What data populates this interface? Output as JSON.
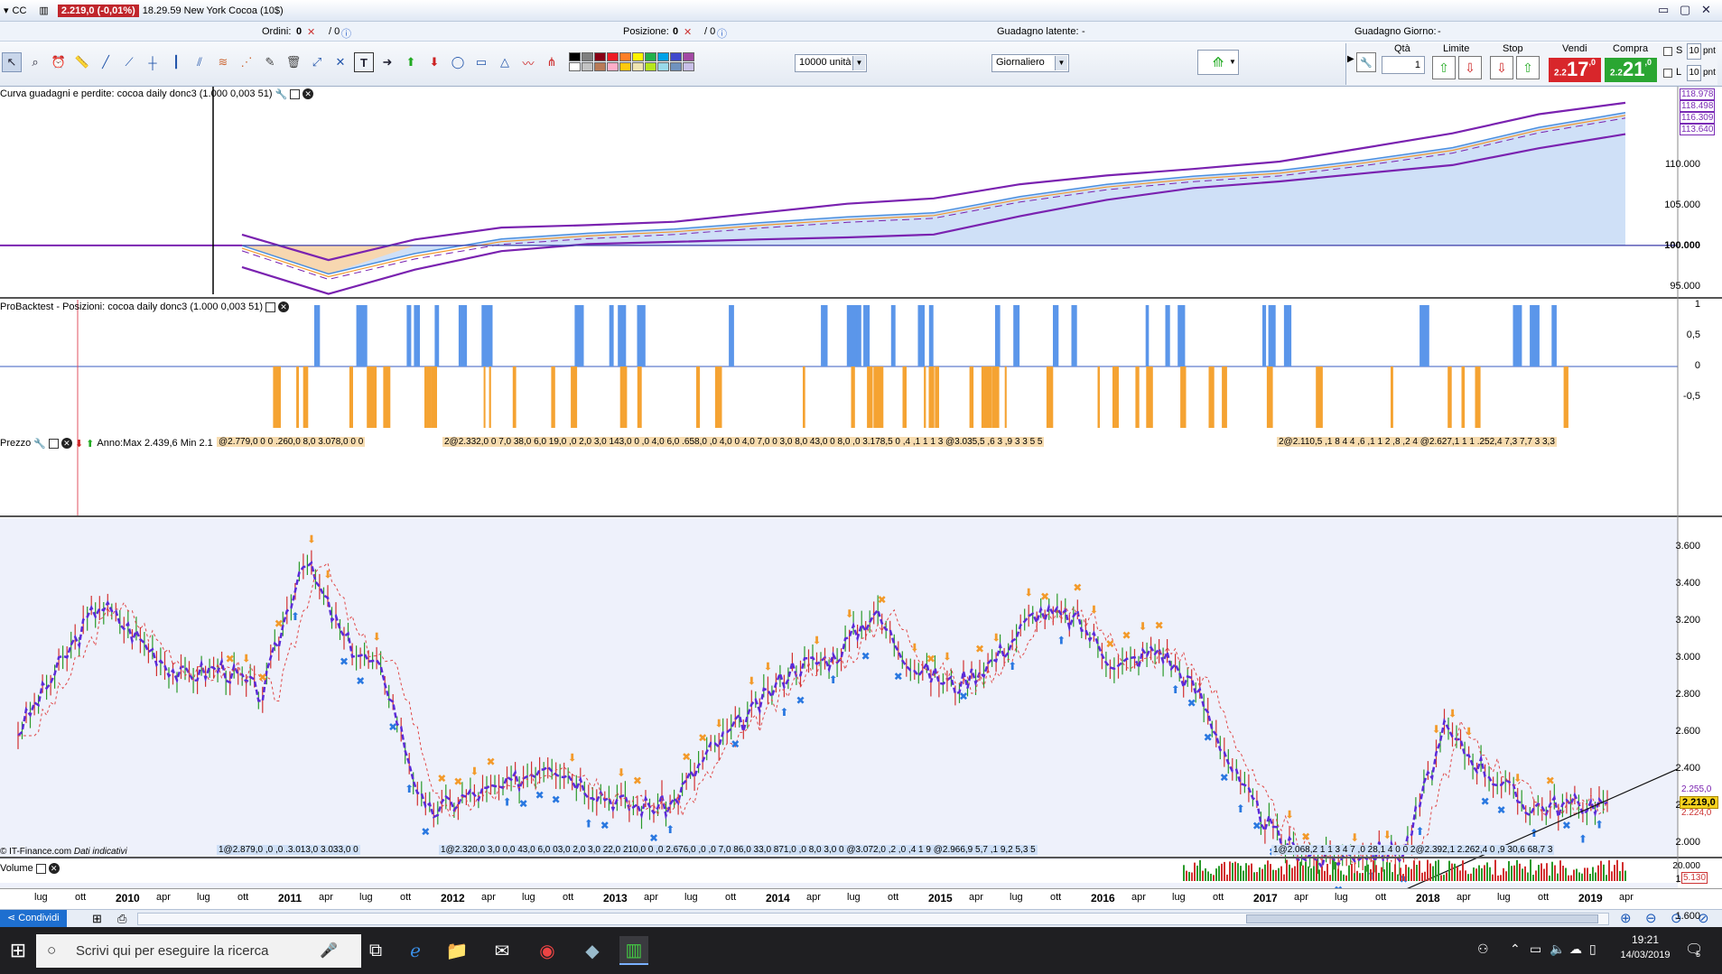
{
  "titlebar": {
    "symbol": "CC",
    "price_change": "2.219,0 (-0,01%)",
    "time_name": "18.29.59 New York Cocoa (10$)"
  },
  "infobar": {
    "orders_label": "Ordini:",
    "orders_value": "0",
    "orders_sep": "/ 0",
    "position_label": "Posizione:",
    "position_value": "0",
    "position_sep": "/ 0",
    "latent_label": "Guadagno latente:",
    "latent_value": "-",
    "day_label": "Guadagno Giorno:",
    "day_value": "-"
  },
  "toolbar": {
    "units_select": "10000 unità",
    "period_select": "Giornaliero",
    "colors": [
      "#000000",
      "#7f7f7f",
      "#880015",
      "#ed1c24",
      "#ff7f27",
      "#fff200",
      "#22b14c",
      "#00a2e8",
      "#3f48cc",
      "#a349a4",
      "#ffffff",
      "#c3c3c3",
      "#b97a57",
      "#ffaec9",
      "#ffc90e",
      "#efe4b0",
      "#b5e61d",
      "#99d9ea",
      "#7092be",
      "#c8bfe7"
    ]
  },
  "order": {
    "qty_label": "Qtà",
    "qty_value": "1",
    "limit_label": "Limite",
    "stop_label": "Stop",
    "sell_label": "Vendi",
    "buy_label": "Compra",
    "sell_small": "2.2",
    "sell_big": "17",
    "sell_dec": ",0",
    "buy_small": "2.2",
    "buy_big": "21",
    "buy_dec": ",0",
    "s_label": "S",
    "l_label": "L",
    "s_value": "10",
    "l_value": "10",
    "pnt": "pnt"
  },
  "panel1": {
    "title": "Curva guadagni e perdite: cocoa daily donc3 (1.000 0,003 51)",
    "yticks": [
      "110.000",
      "105.000",
      "100.000",
      "95.000"
    ],
    "right_labels": [
      "118.978",
      "118.498",
      "116.309",
      "113.640"
    ],
    "right_colors": [
      "#7a2bb5",
      "#7a2bb5",
      "#7a2bb5",
      "#7a2bb5"
    ]
  },
  "panel2": {
    "title": "ProBacktest - Posizioni: cocoa daily donc3 (1.000 0,003 51)",
    "yticks": [
      "1",
      "0,5",
      "0",
      "-0,5"
    ]
  },
  "panel3": {
    "title": "Prezzo",
    "anno": "Anno:Max 2.439,6 Min 2.1",
    "yticks": [
      "3.600",
      "3.400",
      "3.200",
      "3.000",
      "2.800",
      "2.600",
      "2.400",
      "2.200",
      "2.000",
      "1.800",
      "1.600"
    ],
    "last_price": "2.219,0",
    "label_255": "2.255,0",
    "label_224": "2.224,0",
    "top_strips": [
      "@2.779,0 0 0 .260,0 8,0 3.078,0 0 0",
      "2@2.332,0 0 7,0 38,0 6,0 19,0 ,0 2,0 3,0 143,0 0 ,0 4,0 6,0 .658,0 ,0 4,0 0 4,0 7,0 0 3,0 8,0 43,0 0 8,0 ,0 3.178,5 0 ,4 ,1 1 1 3 @3.035,5 ,6 3 ,9 3 3 5 5",
      "2@2.110,5 ,1 8 4 4 ,6 ,1 1 2 ,8 ,2 4 @2.627,1 1 1 .252,4 7,3 7,7 3 3,3"
    ],
    "bottom_strips": [
      "1@2.879,0 ,0 ,0 .3.013,0 3.033,0 0",
      "1@2.320,0 3,0 0,0 43,0 6,0 03,0 2,0 3,0 22,0 210,0 0 ,0 2.676,0 ,0 ,0 7,0 86,0 33,0 871,0 ,0 8,0 3,0 0 @3.072,0 ,2 ,0 ,4 1 9 @2.966,9 5,7 ,1 9,2 5,3 5",
      "1@2.068,2 1 1 3 4 7 ,0 28,1 4 0 0 2@2.392,1 2.262,4 0 ,9 30,6 68,7 3"
    ],
    "copyright": "© IT-Finance.com",
    "indicative": "Dati indicativi"
  },
  "volume": {
    "title": "Volume",
    "yticks": [
      "20.000"
    ],
    "last": "5.130"
  },
  "xaxis": {
    "labels": [
      {
        "t": "lug",
        "b": false
      },
      {
        "t": "ott",
        "b": false
      },
      {
        "t": "2010",
        "b": true
      },
      {
        "t": "apr",
        "b": false
      },
      {
        "t": "lug",
        "b": false
      },
      {
        "t": "ott",
        "b": false
      },
      {
        "t": "2011",
        "b": true
      },
      {
        "t": "apr",
        "b": false
      },
      {
        "t": "lug",
        "b": false
      },
      {
        "t": "ott",
        "b": false
      },
      {
        "t": "2012",
        "b": true
      },
      {
        "t": "apr",
        "b": false
      },
      {
        "t": "lug",
        "b": false
      },
      {
        "t": "ott",
        "b": false
      },
      {
        "t": "2013",
        "b": true
      },
      {
        "t": "apr",
        "b": false
      },
      {
        "t": "lug",
        "b": false
      },
      {
        "t": "ott",
        "b": false
      },
      {
        "t": "2014",
        "b": true
      },
      {
        "t": "apr",
        "b": false
      },
      {
        "t": "lug",
        "b": false
      },
      {
        "t": "ott",
        "b": false
      },
      {
        "t": "2015",
        "b": true
      },
      {
        "t": "apr",
        "b": false
      },
      {
        "t": "lug",
        "b": false
      },
      {
        "t": "ott",
        "b": false
      },
      {
        "t": "2016",
        "b": true
      },
      {
        "t": "apr",
        "b": false
      },
      {
        "t": "lug",
        "b": false
      },
      {
        "t": "ott",
        "b": false
      },
      {
        "t": "2017",
        "b": true
      },
      {
        "t": "apr",
        "b": false
      },
      {
        "t": "lug",
        "b": false
      },
      {
        "t": "ott",
        "b": false
      },
      {
        "t": "2018",
        "b": true
      },
      {
        "t": "apr",
        "b": false
      },
      {
        "t": "lug",
        "b": false
      },
      {
        "t": "ott",
        "b": false
      },
      {
        "t": "2019",
        "b": true
      },
      {
        "t": "apr",
        "b": false
      }
    ]
  },
  "status": {
    "share": "Condividi"
  },
  "taskbar": {
    "search_placeholder": "Scrivi qui per eseguire la ricerca",
    "time": "19:21",
    "date": "14/03/2019",
    "notif": "5"
  },
  "chart_data": {
    "type": "line",
    "title": "New York Cocoa (10$)",
    "x": [
      "2009-06",
      "2009-09",
      "2009-12",
      "2010-03",
      "2010-06",
      "2010-09",
      "2010-12",
      "2011-03",
      "2011-06",
      "2011-09",
      "2011-12",
      "2012-03",
      "2012-06",
      "2012-09",
      "2012-12",
      "2013-03",
      "2013-06",
      "2013-09",
      "2013-12",
      "2014-03",
      "2014-06",
      "2014-09",
      "2014-12",
      "2015-03",
      "2015-06",
      "2015-09",
      "2015-12",
      "2016-03",
      "2016-06",
      "2016-09",
      "2016-12",
      "2017-03",
      "2017-06",
      "2017-09",
      "2017-12",
      "2018-03",
      "2018-06",
      "2018-09",
      "2018-12",
      "2019-03"
    ],
    "series": [
      {
        "values": [
          2600,
          2950,
          3300,
          3100,
          2900,
          2950,
          2800,
          3550,
          3100,
          2900,
          2150,
          2250,
          2300,
          2450,
          2300,
          2200,
          2200,
          2500,
          2700,
          2950,
          3000,
          3250,
          2950,
          2850,
          3000,
          3250,
          3200,
          2950,
          3050,
          2800,
          2300,
          2000,
          1900,
          1950,
          1950,
          2600,
          2400,
          2200,
          2200,
          2219
        ]
      }
    ],
    "equity": [
      100000,
      96500,
      99000,
      100800,
      101500,
      102000,
      102800,
      103500,
      104000,
      106000,
      107500,
      108500,
      109200,
      110500,
      112000,
      114500,
      116309
    ],
    "positions_long": 40,
    "positions_short": 55,
    "ylim": [
      1500,
      3650
    ],
    "ticks": [
      "1.600",
      "1.800",
      "2.000",
      "2.200",
      "2.400",
      "2.600",
      "2.800",
      "3.000",
      "3.200",
      "3.400",
      "3.600"
    ]
  }
}
